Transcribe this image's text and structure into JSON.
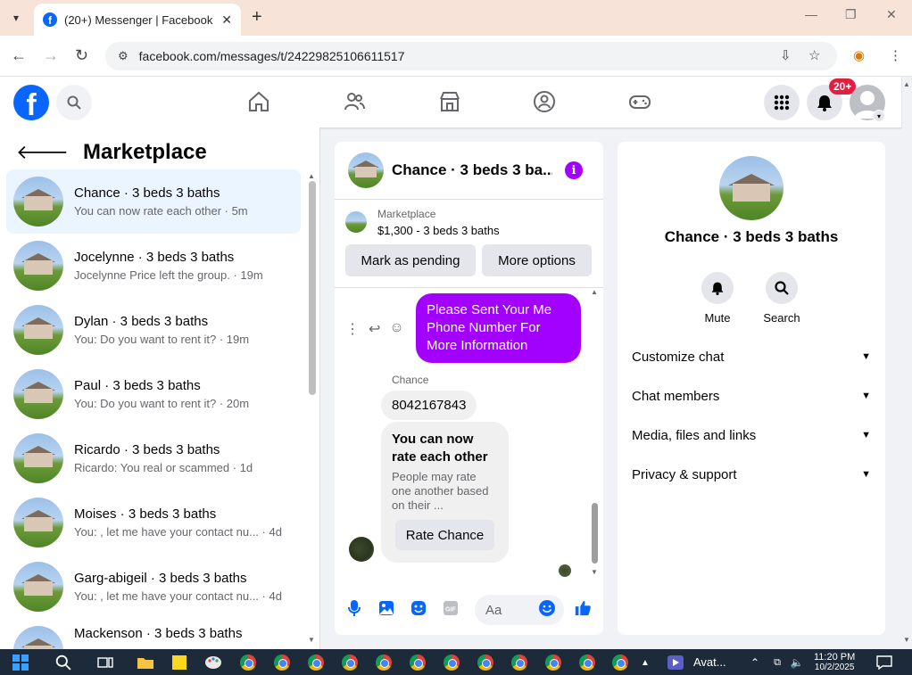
{
  "browser": {
    "tab_title": "(20+) Messenger | Facebook",
    "url": "facebook.com/messages/t/24229825106611517"
  },
  "header": {
    "notification_badge": "20+"
  },
  "left": {
    "title": "Marketplace",
    "conversations": [
      {
        "name": "Chance · 3 beds 3 baths",
        "preview": "You can now rate each other · 5m"
      },
      {
        "name": "Jocelynne · 3 beds 3 baths",
        "preview": "Jocelynne Price left the group. · 19m"
      },
      {
        "name": "Dylan · 3 beds 3 baths",
        "preview": "You: Do you want to rent it? · 19m"
      },
      {
        "name": "Paul · 3 beds 3 baths",
        "preview": "You: Do you want to rent it? · 20m"
      },
      {
        "name": "Ricardo · 3 beds 3 baths",
        "preview": "Ricardo: You real or scammed · 1d"
      },
      {
        "name": "Moises · 3 beds 3 baths",
        "preview": "You: , let me have your contact nu... · 4d"
      },
      {
        "name": "Garg-abigeil · 3 beds 3 baths",
        "preview": "You: , let me have your contact nu... · 4d"
      },
      {
        "name": "Mackenson · 3 beds 3 baths",
        "preview": ""
      }
    ]
  },
  "chat": {
    "title": "Chance · 3 beds 3 ba...",
    "listing_label": "Marketplace",
    "listing_price": "$1,300 - 3 beds 3 baths",
    "mark_pending": "Mark as pending",
    "more_options": "More options",
    "outgoing_message": "Please Sent Your Me Phone Number For More Information",
    "sender_name": "Chance",
    "incoming_message": "8042167843",
    "card_title": "You can now rate each other",
    "card_desc": "People may rate one another based on their ...",
    "rate_button": "Rate Chance",
    "composer_placeholder": "Aa"
  },
  "right": {
    "name": "Chance · 3 beds 3 baths",
    "mute": "Mute",
    "search": "Search",
    "sections": [
      "Customize chat",
      "Chat members",
      "Media, files and links",
      "Privacy & support"
    ]
  },
  "taskbar": {
    "avatar_app": "Avat...",
    "time": "11:20 PM",
    "date": "10/2/2025"
  },
  "colors": {
    "facebook_blue": "#0866ff",
    "messenger_purple": "#a200ff",
    "badge_red": "#e41e3f"
  }
}
